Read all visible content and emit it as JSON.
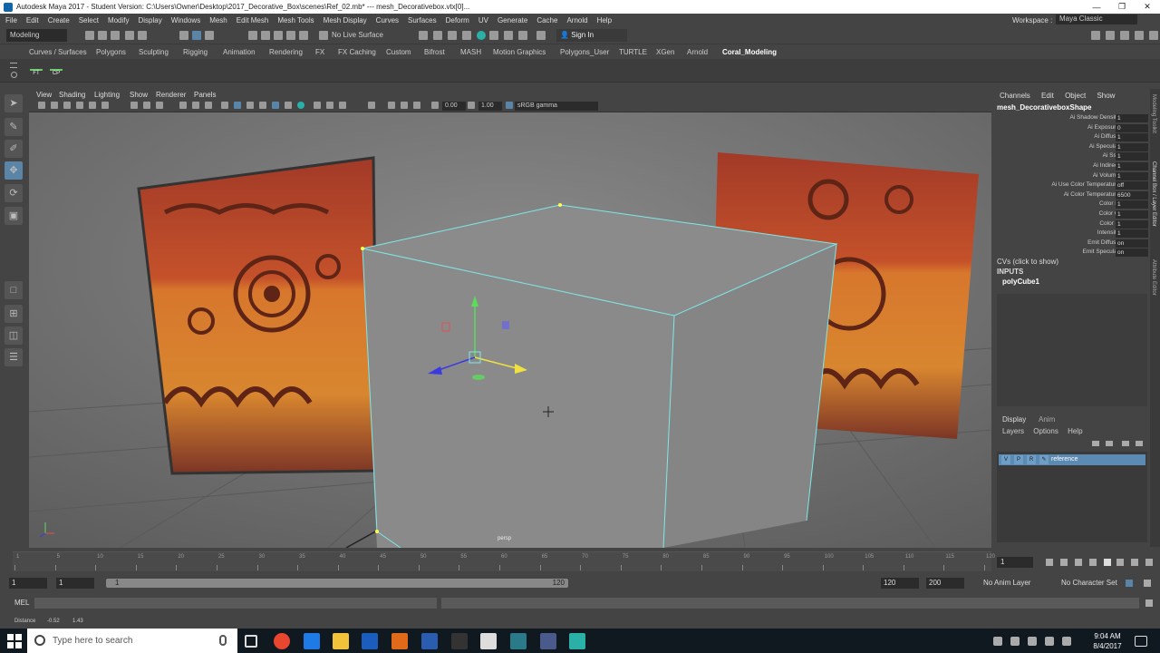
{
  "window": {
    "title": "Autodesk Maya 2017 - Student Version: C:\\Users\\Owner\\Desktop\\2017_Decorative_Box\\scenes\\Ref_02.mb*  ---  mesh_Decorativebox.vtx[0]...",
    "minimize": "—",
    "maximize": "❐",
    "close": "✕"
  },
  "menubar": {
    "items": [
      "File",
      "Edit",
      "Create",
      "Select",
      "Modify",
      "Display",
      "Windows",
      "Mesh",
      "Edit Mesh",
      "Mesh Tools",
      "Mesh Display",
      "Curves",
      "Surfaces",
      "Deform",
      "UV",
      "Generate",
      "Cache",
      "Arnold",
      "Help"
    ],
    "workspace_label": "Workspace :",
    "workspace_value": "Maya Classic"
  },
  "toolbar": {
    "mode": "Modeling",
    "no_live_surface": "No Live Surface",
    "sign_in": "Sign In"
  },
  "shelf": {
    "tabs": [
      "Curves / Surfaces",
      "Polygons",
      "Sculpting",
      "Rigging",
      "Animation",
      "Rendering",
      "FX",
      "FX Caching",
      "Custom",
      "Bifrost",
      "MASH",
      "Motion Graphics",
      "Polygons_User",
      "TURTLE",
      "XGen",
      "Arnold",
      "Coral_Modeling"
    ],
    "active_tab": "Coral_Modeling",
    "icons": [
      "FT",
      "CP"
    ]
  },
  "viewport": {
    "menu": [
      "View",
      "Shading",
      "Lighting",
      "Show",
      "Renderer",
      "Panels"
    ],
    "field_a": "0.00",
    "field_b": "1.00",
    "color_space": "sRGB gamma",
    "camera_label": "persp"
  },
  "channel_box": {
    "menu": [
      "Channels",
      "Edit",
      "Object",
      "Show"
    ],
    "object_name": "mesh_DecorativeboxShape",
    "attributes": [
      {
        "label": "Ai Shadow Density",
        "value": "1"
      },
      {
        "label": "Ai Exposure",
        "value": "0"
      },
      {
        "label": "Ai Diffuse",
        "value": "1"
      },
      {
        "label": "Ai Specular",
        "value": "1"
      },
      {
        "label": "Ai Sss",
        "value": "1"
      },
      {
        "label": "Ai Indirect",
        "value": "1"
      },
      {
        "label": "Ai Volume",
        "value": "1"
      },
      {
        "label": "Ai Use Color Temperature",
        "value": "off"
      },
      {
        "label": "Ai Color Temperature",
        "value": "6500"
      },
      {
        "label": "Color R",
        "value": "1"
      },
      {
        "label": "Color G",
        "value": "1"
      },
      {
        "label": "Color B",
        "value": "1"
      },
      {
        "label": "Intensity",
        "value": "1"
      },
      {
        "label": "Emit Diffuse",
        "value": "on"
      },
      {
        "label": "Emit Specular",
        "value": "on"
      }
    ],
    "cvs_label": "CVs (click to show)",
    "inputs_label": "INPUTS",
    "input_node": "polyCube1"
  },
  "layer_editor": {
    "tabs": [
      "Display",
      "Anim"
    ],
    "menu": [
      "Layers",
      "Options",
      "Help"
    ],
    "layer_flags": [
      "V",
      "P",
      "R"
    ],
    "layer_name": "reference"
  },
  "side_tabs": [
    "Modeling Toolkit",
    "Channel Box / Layer Editor",
    "Attribute Editor"
  ],
  "time_slider": {
    "tick_labels": [
      "1",
      "5",
      "10",
      "15",
      "20",
      "25",
      "30",
      "35",
      "40",
      "45",
      "50",
      "55",
      "60",
      "65",
      "70",
      "75",
      "80",
      "85",
      "90",
      "95",
      "100",
      "105",
      "110",
      "115",
      "120"
    ],
    "current_frame": "1"
  },
  "range": {
    "start": "1",
    "playback_start": "1",
    "slider_start": "1",
    "slider_end": "120",
    "playback_end": "120",
    "end": "200",
    "anim_layer": "No Anim Layer",
    "character_set": "No Character Set"
  },
  "command_line": {
    "label": "MEL"
  },
  "help_line": {
    "label": "Distance",
    "value_a": "-0.52",
    "value_b": "1.43"
  },
  "taskbar": {
    "search_placeholder": "Type here to search",
    "time": "9:04 AM",
    "date": "8/4/2017"
  },
  "colors": {
    "selection_cyan": "#7fe8e8",
    "maya_accent": "#2bb0a8",
    "layer_highlight": "#5b8ab3"
  }
}
